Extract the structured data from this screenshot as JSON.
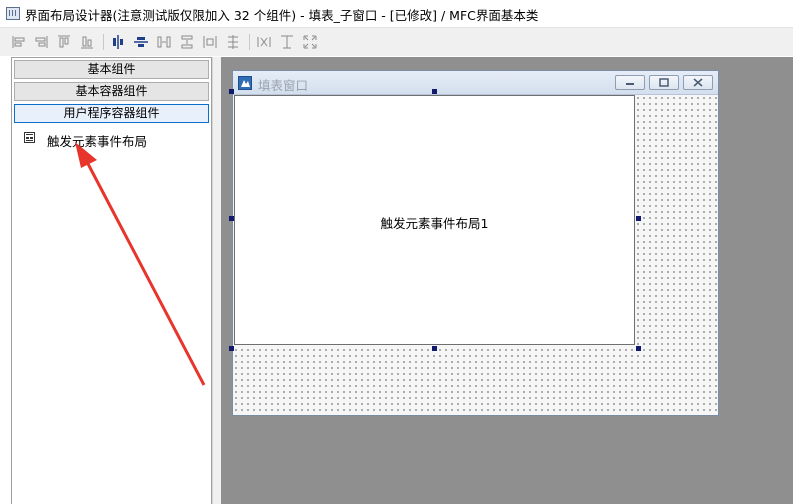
{
  "window": {
    "title": "界面布局设计器(注意测试版仅限加入 32 个组件) - 填表_子窗口 - [已修改] / MFC界面基本类"
  },
  "toolbar": {
    "buttons": [
      {
        "name": "align-left-icon"
      },
      {
        "name": "align-right-icon"
      },
      {
        "name": "align-top-icon"
      },
      {
        "name": "align-bottom-icon"
      },
      {
        "name": "align-center-vertical-icon"
      },
      {
        "name": "align-center-horizontal-icon"
      },
      {
        "name": "distribute-horizontal-icon"
      },
      {
        "name": "distribute-vertical-icon"
      },
      {
        "name": "space-evenly-icon"
      },
      {
        "name": "same-width-icon"
      },
      {
        "name": "same-height-icon"
      },
      {
        "name": "same-size-icon"
      }
    ]
  },
  "left_panel": {
    "categories": [
      "基本组件",
      "基本容器组件",
      "用户程序容器组件"
    ],
    "active_category": "用户程序容器组件",
    "items": [
      "触发元素事件布局"
    ]
  },
  "form": {
    "title": "填表窗口",
    "component_label": "触发元素事件布局1"
  },
  "colors": {
    "workspace_bg": "#8f8f8f",
    "annotation_arrow": "#e8352b",
    "selection_handle": "#111a6e"
  }
}
